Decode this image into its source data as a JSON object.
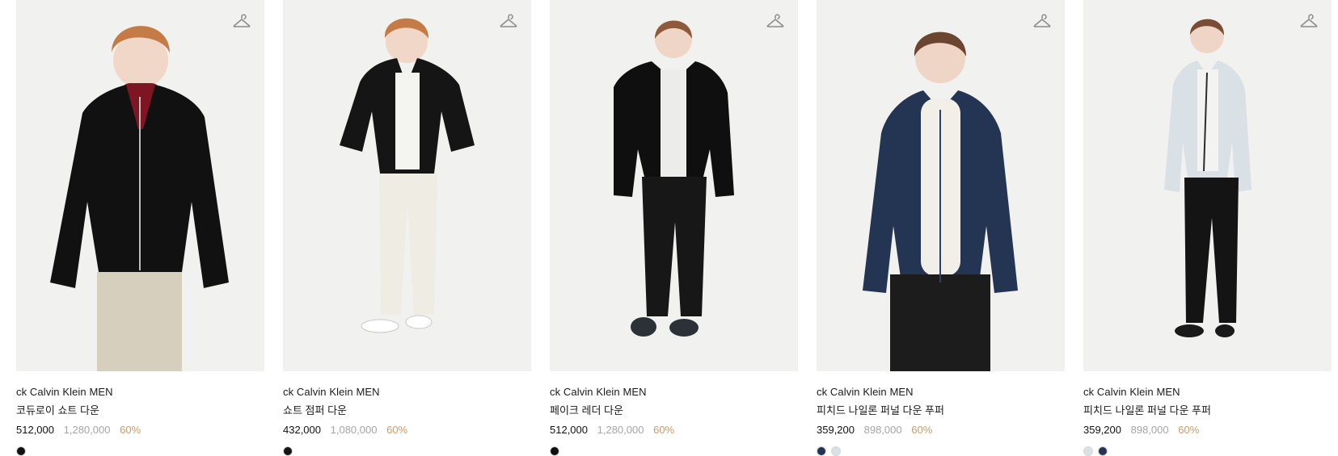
{
  "products": [
    {
      "brand": "ck Calvin Klein MEN",
      "name": "코듀로이 쇼트 다운",
      "sale_price": "512,000",
      "original_price": "1,280,000",
      "discount": "60%",
      "jacket_color": "#111111",
      "inner_color": "#7d1523",
      "pants_color": "#d7cfbd"
    },
    {
      "brand": "ck Calvin Klein MEN",
      "name": "쇼트 점퍼 다운",
      "sale_price": "432,000",
      "original_price": "1,080,000",
      "discount": "60%",
      "jacket_color": "#151515",
      "inner_color": "#f3f3f0",
      "pants_color": "#efece3"
    },
    {
      "brand": "ck Calvin Klein MEN",
      "name": "페이크 레더 다운",
      "sale_price": "512,000",
      "original_price": "1,280,000",
      "discount": "60%",
      "jacket_color": "#0f0f0f",
      "inner_color": "#ececeb",
      "pants_color": "#171717"
    },
    {
      "brand": "ck Calvin Klein MEN",
      "name": "피치드 나일론 퍼널 다운 푸퍼",
      "sale_price": "359,200",
      "original_price": "898,000",
      "discount": "60%",
      "jacket_color": "#243553",
      "inner_color": "#f1efe8",
      "pants_color": "#1c1c1c"
    },
    {
      "brand": "ck Calvin Klein MEN",
      "name": "피치드 나일론 퍼널 다운 푸퍼",
      "sale_price": "359,200",
      "original_price": "898,000",
      "discount": "60%",
      "jacket_color": "#d9e0e6",
      "inner_color": "#f3f3f1",
      "pants_color": "#141414"
    }
  ],
  "icons": {
    "wishlist": "hanger-icon"
  }
}
